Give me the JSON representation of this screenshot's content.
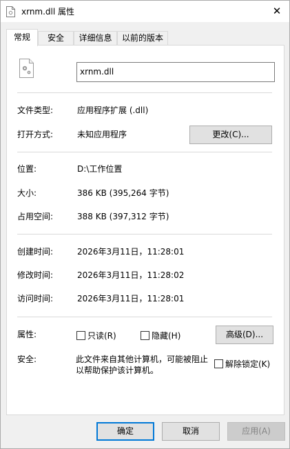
{
  "window": {
    "title": "xrnm.dll 属性",
    "file_icon": "dll-file-icon",
    "close_glyph": "✕"
  },
  "tabs": [
    {
      "label": "常规",
      "active": true
    },
    {
      "label": "安全",
      "active": false
    },
    {
      "label": "详细信息",
      "active": false
    },
    {
      "label": "以前的版本",
      "active": false
    }
  ],
  "general": {
    "file_name": "xrnm.dll",
    "file_type_label": "文件类型:",
    "file_type_value": "应用程序扩展 (.dll)",
    "opens_with_label": "打开方式:",
    "opens_with_value": "未知应用程序",
    "change_button": "更改(C)...",
    "location_label": "位置:",
    "location_value": "D:\\工作位置",
    "size_label": "大小:",
    "size_value": "386 KB (395,264 字节)",
    "size_on_disk_label": "占用空间:",
    "size_on_disk_value": "388 KB (397,312 字节)",
    "created_label": "创建时间:",
    "created_value": "2026年3月11日，11:28:01",
    "modified_label": "修改时间:",
    "modified_value": "2026年3月11日，11:28:02",
    "accessed_label": "访问时间:",
    "accessed_value": "2026年3月11日，11:28:01",
    "attributes_label": "属性:",
    "readonly_label": "只读(R)",
    "hidden_label": "隐藏(H)",
    "advanced_button": "高级(D)...",
    "security_label": "安全:",
    "security_text_line1": "此文件来自其他计算机，可能被阻止",
    "security_text_line2": "以帮助保护该计算机。",
    "unblock_label": "解除锁定(K)"
  },
  "footer": {
    "ok": "确定",
    "cancel": "取消",
    "apply": "应用(A)"
  }
}
